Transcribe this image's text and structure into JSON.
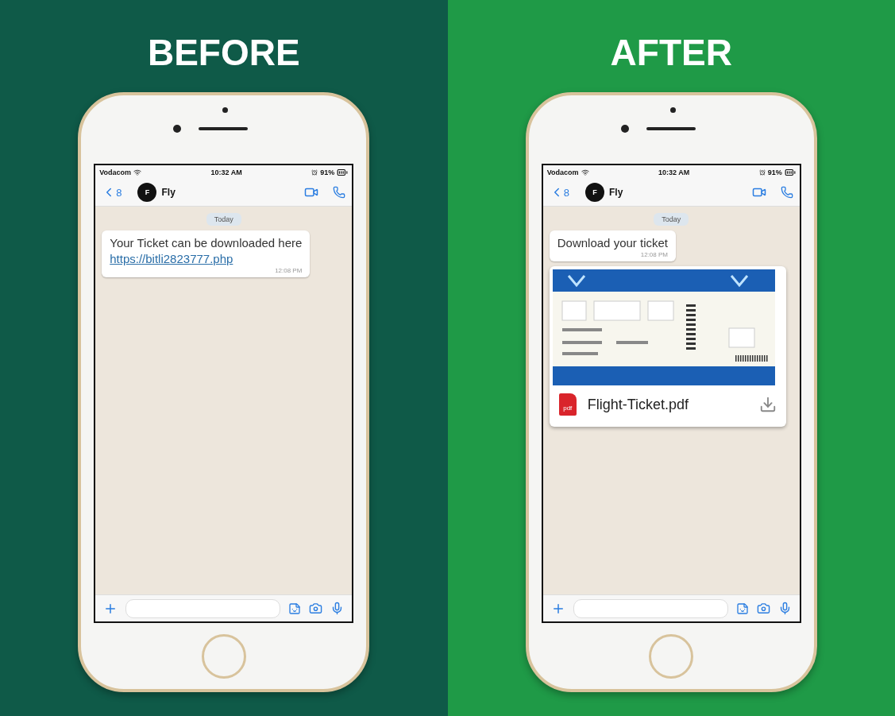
{
  "panels": [
    {
      "title": "BEFORE",
      "color": "#0f5a48",
      "phone": {
        "status": {
          "carrier": "Vodacom",
          "time": "10:32 AM",
          "battery": "91%"
        },
        "header": {
          "back_count": "8",
          "avatar": "F",
          "name": "Fly"
        },
        "date": "Today",
        "messages": [
          {
            "kind": "text",
            "text": "Your Ticket can be downloaded here",
            "link": "https://bitli2823777.php",
            "time": "12:08 PM"
          }
        ]
      }
    },
    {
      "title": "AFTER",
      "color": "#1f9a47",
      "phone": {
        "status": {
          "carrier": "Vodacom",
          "time": "10:32 AM",
          "battery": "91%"
        },
        "header": {
          "back_count": "8",
          "avatar": "F",
          "name": "Fly"
        },
        "date": "Today",
        "messages": [
          {
            "kind": "text",
            "text": "Download your ticket",
            "time": "12:08 PM"
          },
          {
            "kind": "document",
            "filename": "Flight-Ticket.pdf",
            "file_type": "pdf"
          }
        ]
      }
    }
  ]
}
